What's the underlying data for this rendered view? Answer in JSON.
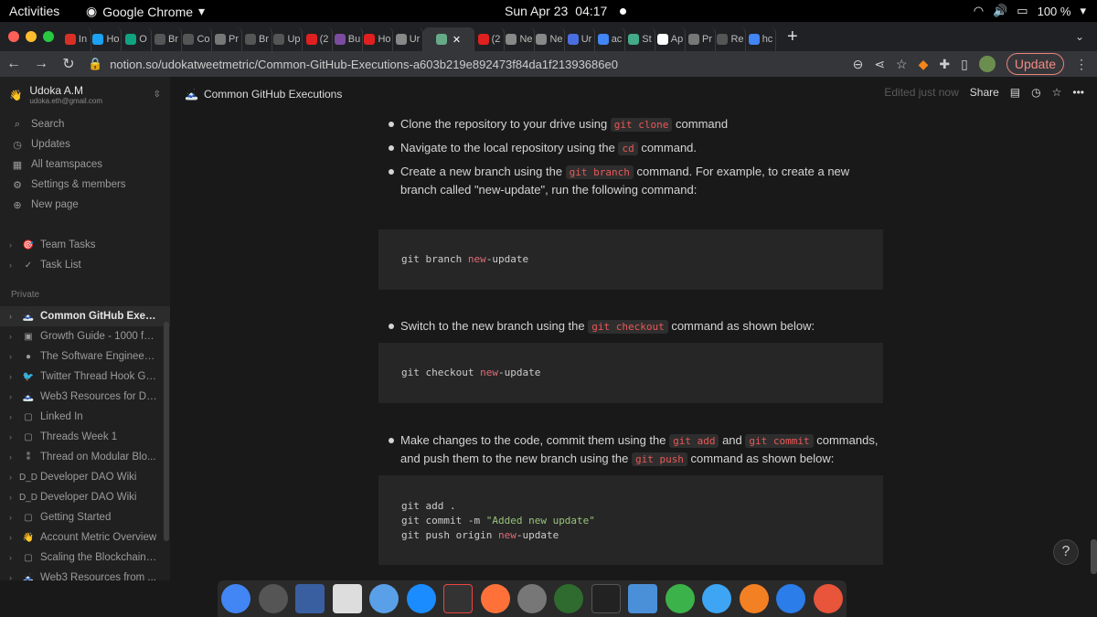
{
  "ubuntu": {
    "activities": "Activities",
    "app": "Google Chrome",
    "date": "Sun Apr 23",
    "time": "04:17",
    "battery": "100 %"
  },
  "tabs": [
    {
      "label": "In",
      "color": "#d93025"
    },
    {
      "label": "Ho",
      "color": "#1da1f2"
    },
    {
      "label": "O",
      "color": "#10a37f"
    },
    {
      "label": "Br",
      "color": "#555"
    },
    {
      "label": "Co",
      "color": "#555"
    },
    {
      "label": "Pr",
      "color": "#777"
    },
    {
      "label": "Br",
      "color": "#555"
    },
    {
      "label": "Up",
      "color": "#555"
    },
    {
      "label": "(2",
      "color": "#e02020"
    },
    {
      "label": "Bu",
      "color": "#7b4ba0"
    },
    {
      "label": "Ho",
      "color": "#e02020"
    },
    {
      "label": "Ur",
      "color": "#888"
    },
    {
      "label": "",
      "color": "#6a8",
      "active": true
    },
    {
      "label": "(2",
      "color": "#e02020"
    },
    {
      "label": "Ne",
      "color": "#888"
    },
    {
      "label": "Ne",
      "color": "#888"
    },
    {
      "label": "Ur",
      "color": "#4a6ee0"
    },
    {
      "label": "ac",
      "color": "#4285f4"
    },
    {
      "label": "St",
      "color": "#4a8"
    },
    {
      "label": "Ap",
      "color": "#fff"
    },
    {
      "label": "Pr",
      "color": "#777"
    },
    {
      "label": "Re",
      "color": "#555"
    },
    {
      "label": "hc",
      "color": "#4285f4"
    }
  ],
  "browser": {
    "url": "notion.so/udokatweetmetric/Common-GitHub-Executions-a603b219e892473f84da1f21393686e0",
    "update": "Update"
  },
  "sidebar": {
    "ws_name": "Udoka A.M",
    "ws_email": "udoka.eth@gmail.com",
    "nav": [
      {
        "label": "Search",
        "icon": "⌕"
      },
      {
        "label": "Updates",
        "icon": "◷"
      },
      {
        "label": "All teamspaces",
        "icon": "▦"
      },
      {
        "label": "Settings & members",
        "icon": "⚙"
      },
      {
        "label": "New page",
        "icon": "⊕"
      }
    ],
    "team_pages": [
      {
        "label": "Team Tasks",
        "icon": "🎯"
      },
      {
        "label": "Task List",
        "icon": "✓"
      }
    ],
    "private_label": "Private",
    "pages": [
      {
        "label": "Common GitHub Exec...",
        "icon": "🗻",
        "active": true
      },
      {
        "label": "Growth Guide - 1000 fol...",
        "icon": "▣"
      },
      {
        "label": "The Software Engineer ...",
        "icon": "●"
      },
      {
        "label": "Twitter Thread Hook Gu...",
        "icon": "🐦"
      },
      {
        "label": "Web3 Resources for De...",
        "icon": "🗻"
      },
      {
        "label": "Linked In",
        "icon": "▢"
      },
      {
        "label": "Threads Week 1",
        "icon": "▢"
      },
      {
        "label": "Thread on Modular Blo...",
        "icon": "⁑"
      },
      {
        "label": "Developer DAO Wiki",
        "icon": "D_D"
      },
      {
        "label": "Developer DAO Wiki",
        "icon": "D_D"
      },
      {
        "label": "Getting Started",
        "icon": "▢"
      },
      {
        "label": "Account Metric Overview",
        "icon": "👋"
      },
      {
        "label": "Scaling the Blockchain ...",
        "icon": "▢"
      },
      {
        "label": "Web3 Resources from ...",
        "icon": "🗻"
      }
    ]
  },
  "topbar": {
    "title": "Common GitHub Executions",
    "edited": "Edited just now",
    "share": "Share"
  },
  "content": {
    "b1": {
      "pre": "Clone the repository to your drive using ",
      "code": "git clone",
      "post": " command"
    },
    "b2": {
      "pre": "Navigate to the local repository using the ",
      "code": "cd",
      "post": " command."
    },
    "b3": {
      "pre": "Create a new branch using the ",
      "code": "git branch",
      "post": " command. For example, to create a new branch called \"new-update\", run the following command:"
    },
    "c1": {
      "a": "git branch ",
      "b": "new",
      "c": "-update"
    },
    "b4": {
      "pre": "Switch to the new branch using the ",
      "code": "git checkout",
      "post": " command as shown below:"
    },
    "c2": {
      "a": "git checkout ",
      "b": "new",
      "c": "-update"
    },
    "b5": {
      "pre": "Make changes to the code, commit them using the ",
      "code1": "git add",
      "mid": " and ",
      "code2": "git commit",
      "mid2": " commands, and push them to the new branch using the ",
      "code3": "git push",
      "post": " command as shown below:"
    },
    "c3": {
      "l1": "git add .",
      "l2a": "git commit -m ",
      "l2b": "\"Added new update\"",
      "l3a": "git push origin ",
      "l3b": "new",
      "l3c": "-update"
    }
  },
  "help": "?"
}
